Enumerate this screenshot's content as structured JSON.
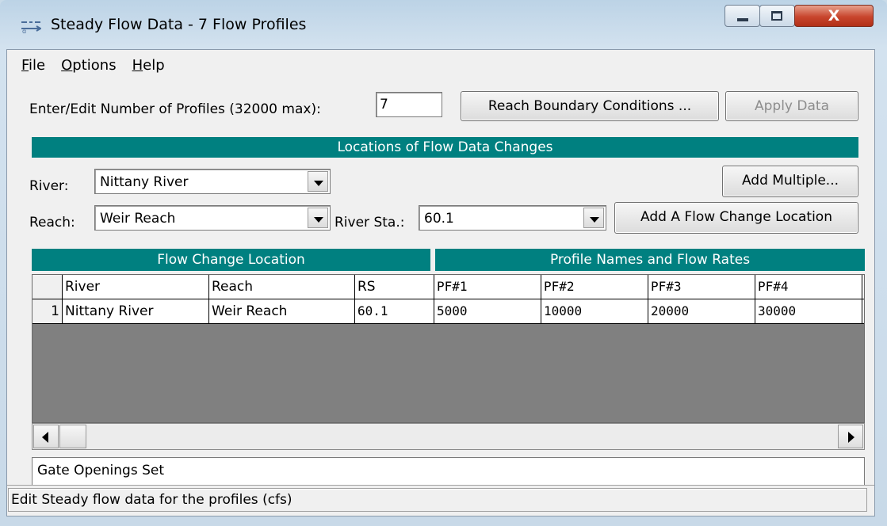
{
  "window": {
    "title": "Steady Flow Data - 7 Flow Profiles",
    "controls": {
      "minimize": "minimize",
      "maximize": "maximize",
      "close": "X"
    }
  },
  "menu": [
    {
      "accel": "F",
      "rest": "ile"
    },
    {
      "accel": "O",
      "rest": "ptions"
    },
    {
      "accel": "H",
      "rest": "elp"
    }
  ],
  "profiles": {
    "label": "Enter/Edit Number of Profiles (32000 max):",
    "value": "7"
  },
  "buttons": {
    "reach_boundary": "Reach Boundary Conditions ...",
    "apply_data": "Apply Data",
    "add_multiple": "Add Multiple...",
    "add_flow_change": "Add A Flow Change Location"
  },
  "locations_header": "Locations of Flow Data Changes",
  "river": {
    "label": "River:",
    "value": "Nittany River"
  },
  "reach": {
    "label": "Reach:",
    "value": "Weir Reach"
  },
  "river_sta": {
    "label": "River Sta.:",
    "value": "60.1"
  },
  "table": {
    "left_header": "Flow Change Location",
    "right_header": "Profile Names and Flow Rates",
    "columns": [
      "River",
      "Reach",
      "RS",
      "PF#1",
      "PF#2",
      "PF#3",
      "PF#4"
    ],
    "rows": [
      {
        "num": "1",
        "river": "Nittany River",
        "reach": "Weir Reach",
        "rs": "60.1",
        "pf1": "5000",
        "pf2": "10000",
        "pf3": "20000",
        "pf4": "30000"
      }
    ]
  },
  "description": "Gate Openings Set",
  "status": "Edit Steady flow data for the profiles (cfs)",
  "colors": {
    "header_bg": "#008080",
    "grid_empty": "#808080",
    "close_button": "#c8452d"
  }
}
